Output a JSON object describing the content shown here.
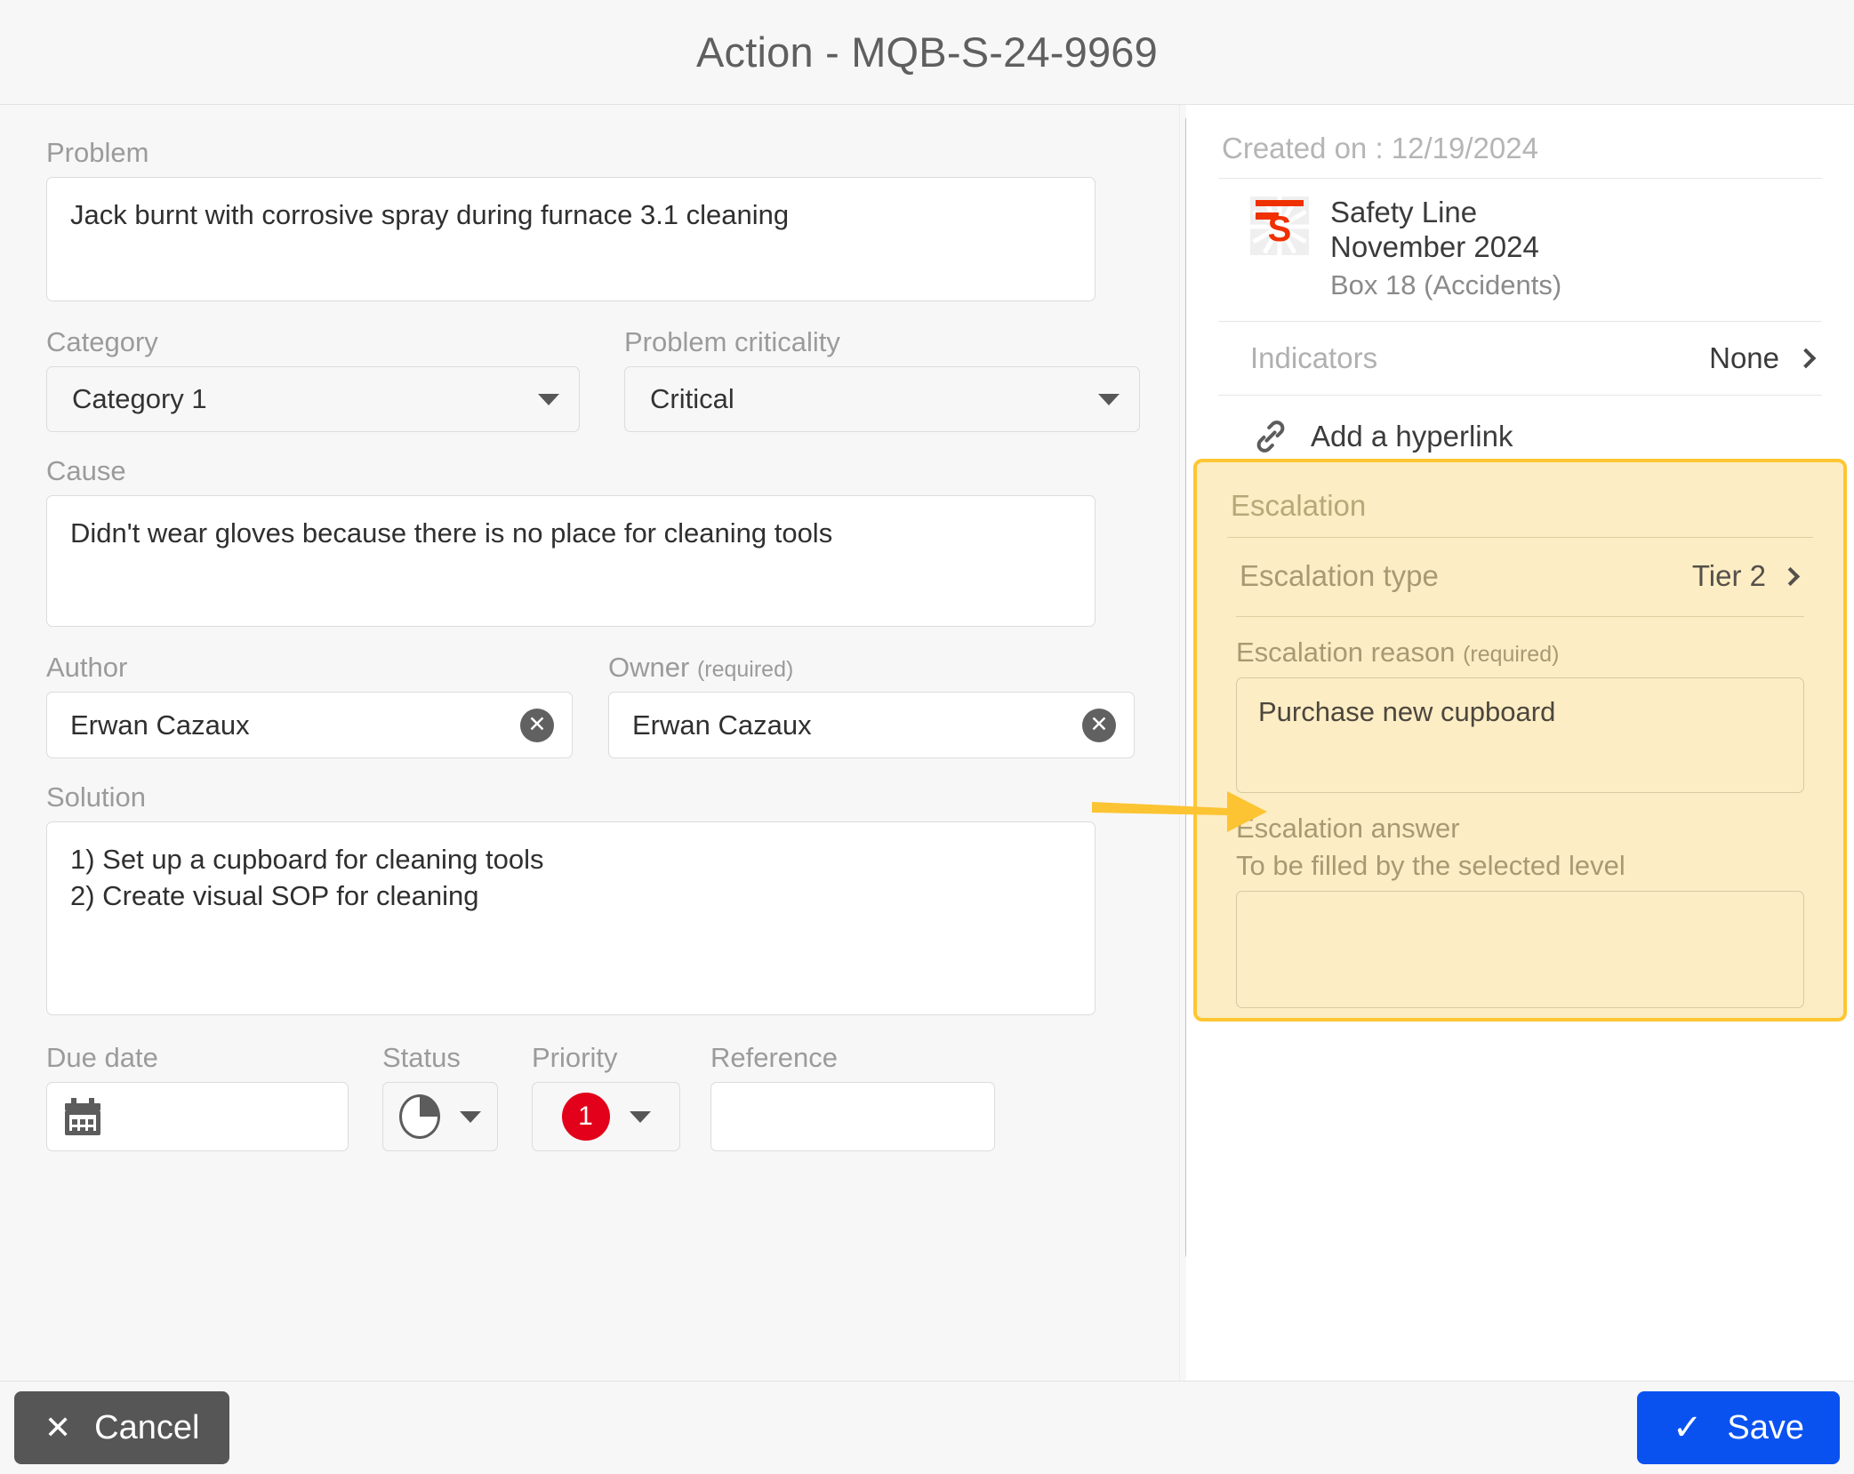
{
  "window": {
    "title": "Action - MQB-S-24-9969"
  },
  "form": {
    "problem": {
      "label": "Problem",
      "value": "Jack burnt with corrosive spray during furnace 3.1 cleaning",
      "placeholder": ""
    },
    "category": {
      "label": "Category",
      "value": "Category 1"
    },
    "criticality": {
      "label": "Problem criticality",
      "value": "Critical"
    },
    "cause": {
      "label": "Cause",
      "value": "Didn't wear gloves because there is no place for cleaning tools",
      "placeholder": ""
    },
    "author": {
      "label": "Author",
      "value": "Erwan Cazaux"
    },
    "owner": {
      "label": "Owner",
      "required_suffix": "(required)",
      "value": "Erwan Cazaux"
    },
    "solution": {
      "label": "Solution",
      "value": "1) Set up a cupboard for cleaning tools\n2) Create visual SOP for cleaning"
    },
    "due_date": {
      "label": "Due date",
      "value": "",
      "icon": "calendar-icon"
    },
    "status": {
      "label": "Status",
      "value": "",
      "icon": "pie-quarter-icon"
    },
    "priority": {
      "label": "Priority",
      "value": "1"
    },
    "reference": {
      "label": "Reference",
      "value": ""
    }
  },
  "sidebar": {
    "created_on": "Created on : 12/19/2024",
    "context": {
      "icon": "safety-line-icon",
      "line1": "Safety Line",
      "line2": "November 2024",
      "line3": "Box 18 (Accidents)"
    },
    "indicators": {
      "label": "Indicators",
      "value": "None",
      "chevron": "chevron-right-icon"
    },
    "hyperlink": {
      "icon": "link-icon",
      "label": "Add a hyperlink"
    },
    "escalation": {
      "title": "Escalation",
      "type": {
        "label": "Escalation type",
        "value": "Tier 2",
        "chevron": "chevron-right-icon"
      },
      "reason": {
        "label": "Escalation reason",
        "required_suffix": "(required)",
        "value": "Purchase new cupboard"
      },
      "answer": {
        "label": "Escalation answer",
        "sublabel": "To be filled by the selected level",
        "value": ""
      }
    }
  },
  "footer": {
    "cancel_label": "Cancel",
    "cancel_icon": "close-icon",
    "save_label": "Save",
    "save_icon": "check-icon"
  },
  "colors": {
    "accent_blue": "#0a52f0",
    "priority_red": "#e2001a",
    "escalation_bg": "#fdedc4",
    "escalation_border": "#ffc633",
    "annotation_arrow": "#fcc433",
    "safety_red": "#f03000"
  }
}
